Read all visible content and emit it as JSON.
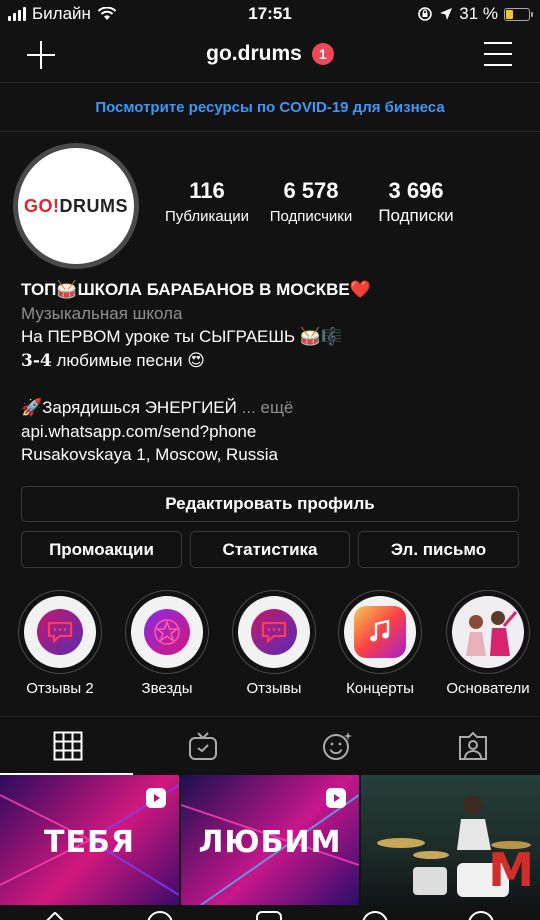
{
  "status_bar": {
    "carrier": "Билайн",
    "time": "17:51",
    "battery_text": "31 %",
    "battery_level": 0.31,
    "battery_color": "#f4c430"
  },
  "header": {
    "username": "go.drums",
    "notification_count": "1",
    "left_icon": "plus-icon",
    "right_icon": "hamburger-menu-icon"
  },
  "banner": {
    "text": "Посмотрите ресурсы по COVID-19 для бизнеса",
    "color": "#3f97f6"
  },
  "profile": {
    "logo_go": "GO!",
    "logo_drums": "DRUMS",
    "stats": [
      {
        "value": "116",
        "label": "Публикации"
      },
      {
        "value": "6 578",
        "label": "Подписчики"
      },
      {
        "value": "3 696",
        "label": "Подписки"
      }
    ]
  },
  "bio": {
    "title": "ТОП🥁ШКОЛА БАРАБАНОВ В МОСКВЕ❤️",
    "category": "Музыкальная школа",
    "line1": "На ПЕРВОМ уроке ты СЫГРАЕШЬ 🥁🎼",
    "line2_bold": "3-4",
    "line2_rest": " любимые песни 😍",
    "line3": "🚀Зарядишься ЭНЕРГИЕЙ",
    "more": "... ещё",
    "link": "api.whatsapp.com/send?phone",
    "address": "Rusakovskaya 1, Moscow, Russia"
  },
  "buttons": {
    "edit_profile": "Редактировать профиль",
    "promotions": "Промоакции",
    "statistics": "Статистика",
    "email": "Эл. письмо"
  },
  "highlights": [
    {
      "label": "Отзывы 2",
      "icon": "speech-bubble-icon"
    },
    {
      "label": "Звезды",
      "icon": "star-icon"
    },
    {
      "label": "Отзывы",
      "icon": "speech-bubble-icon"
    },
    {
      "label": "Концерты",
      "icon": "music-note-icon"
    },
    {
      "label": "Основатели",
      "icon": "founders-photo"
    }
  ],
  "tabs": [
    {
      "icon": "grid-icon",
      "active": true
    },
    {
      "icon": "igtv-icon",
      "active": false
    },
    {
      "icon": "reels-effects-icon",
      "active": false
    },
    {
      "icon": "tagged-user-icon",
      "active": false
    }
  ],
  "posts": [
    {
      "text": "ТЕБЯ",
      "type": "reel"
    },
    {
      "text": "ЛЮБИМ",
      "type": "reel"
    },
    {
      "text": "",
      "type": "photo"
    }
  ],
  "watermark": "M"
}
